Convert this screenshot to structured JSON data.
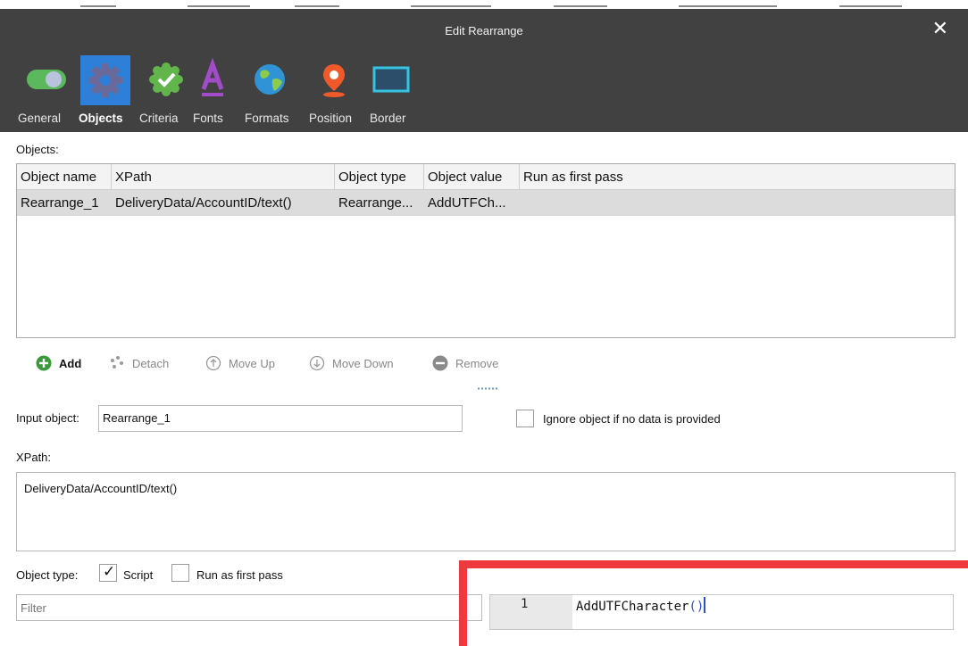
{
  "window": {
    "title": "Edit Rearrange",
    "close_glyph": "✕"
  },
  "toolbar": {
    "tabs": [
      {
        "label": "General",
        "icon": "toggle-icon"
      },
      {
        "label": "Objects",
        "icon": "gear-icon",
        "active": true
      },
      {
        "label": "Criteria",
        "icon": "check-badge-icon"
      },
      {
        "label": "Fonts",
        "icon": "font-a-icon"
      },
      {
        "label": "Formats",
        "icon": "globe-icon"
      },
      {
        "label": "Position",
        "icon": "location-pin-icon"
      },
      {
        "label": "Border",
        "icon": "border-box-icon"
      }
    ]
  },
  "objects": {
    "section_label": "Objects:",
    "columns": [
      "Object name",
      "XPath",
      "Object type",
      "Object value",
      "Run as first pass"
    ],
    "rows": [
      {
        "name": "Rearrange_1",
        "xpath": "DeliveryData/AccountID/text()",
        "type": "Rearrange...",
        "value": "AddUTFCh...",
        "first_pass": ""
      }
    ]
  },
  "actions": {
    "add": "Add",
    "detach": "Detach",
    "move_up": "Move Up",
    "move_down": "Move Down",
    "remove": "Remove"
  },
  "input_object": {
    "label": "Input object:",
    "value": "Rearrange_1"
  },
  "ignore_object": {
    "label": "Ignore object if no data  is provided",
    "checked": false
  },
  "xpath": {
    "label": "XPath:",
    "value": "DeliveryData/AccountID/text()"
  },
  "object_type": {
    "label": "Object type:",
    "script_label": "Script",
    "script_checked": true,
    "first_pass_label": "Run as first pass",
    "first_pass_checked": false
  },
  "filter": {
    "placeholder": "Filter"
  },
  "editor": {
    "line_number": "1",
    "code_fn": "AddUTFCharacter",
    "code_parens": "()"
  },
  "colors": {
    "titlebar": "#414141",
    "active_tab": "#2d7fd7",
    "highlight": "#ee3a3e",
    "selected_row": "#dcdcdc"
  }
}
